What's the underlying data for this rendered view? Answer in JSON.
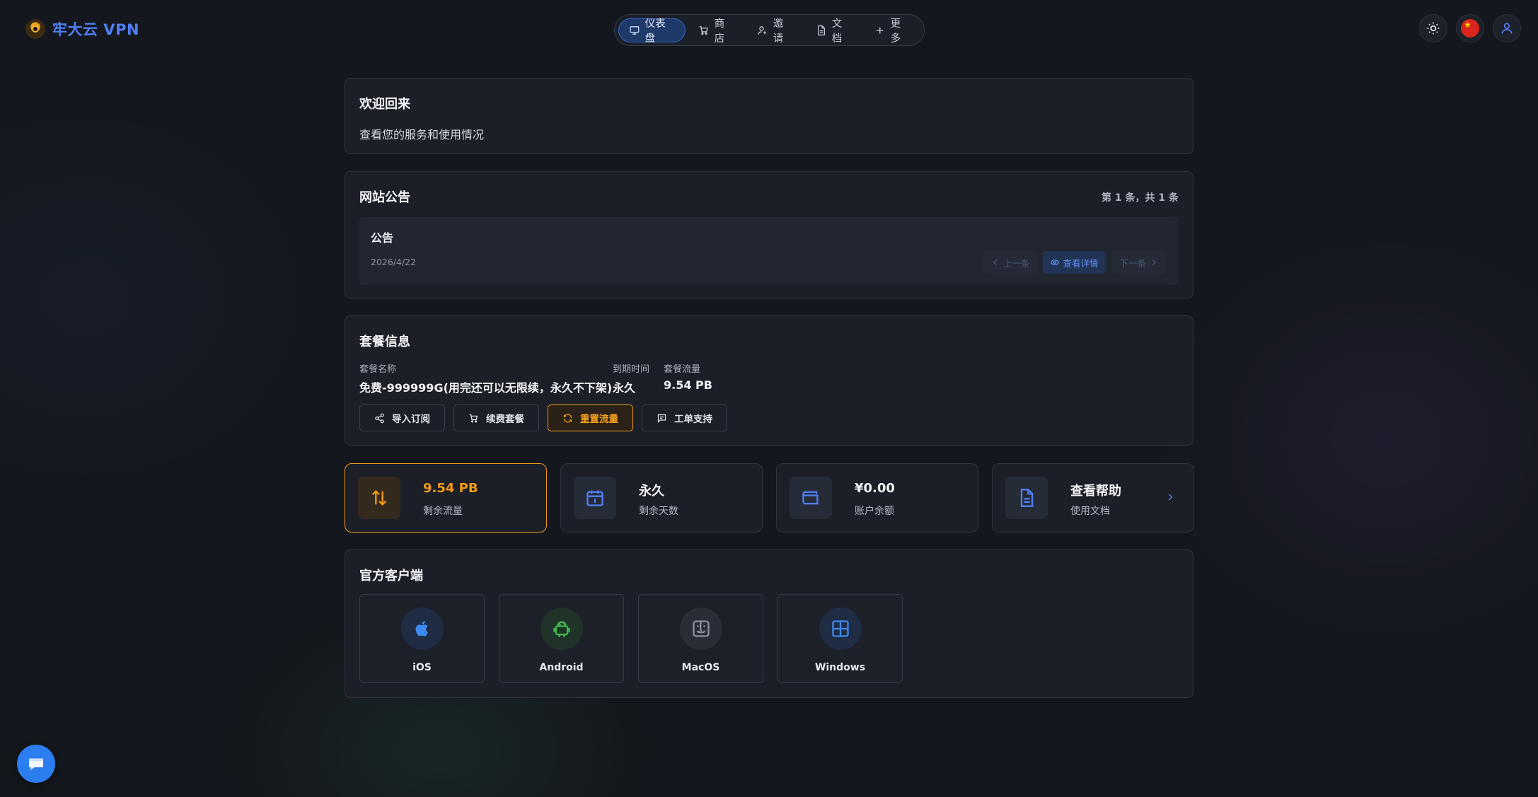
{
  "brand": {
    "name": "牢大云 VPN"
  },
  "nav": {
    "items": [
      {
        "label": "仪表盘",
        "icon": "monitor-icon",
        "active": true
      },
      {
        "label": "商店",
        "icon": "cart-icon"
      },
      {
        "label": "邀请",
        "icon": "user-plus-icon"
      },
      {
        "label": "文档",
        "icon": "document-icon"
      },
      {
        "label": "更多",
        "icon": "plus-icon"
      }
    ]
  },
  "welcome": {
    "title": "欢迎回来",
    "subtitle": "查看您的服务和使用情况"
  },
  "notice": {
    "title": "网站公告",
    "pager": "第 1 条，共 1 条",
    "item": {
      "title": "公告",
      "date": "2026/4/22"
    },
    "prev_label": "上一条",
    "detail_label": "查看详情",
    "next_label": "下一条"
  },
  "plan": {
    "title": "套餐信息",
    "name_label": "套餐名称",
    "name_value": "免费-999999G(用完还可以无限续，永久不下架)",
    "expire_label": "到期时间",
    "expire_value": "永久",
    "traffic_label": "套餐流量",
    "traffic_value": "9.54 PB",
    "actions": {
      "import": "导入订阅",
      "renew": "续费套餐",
      "reset": "重置流量",
      "ticket": "工单支持"
    }
  },
  "stats": [
    {
      "value": "9.54 PB",
      "label": "剩余流量",
      "icon": "traffic-icon"
    },
    {
      "value": "永久",
      "label": "剩余天数",
      "icon": "calendar-icon"
    },
    {
      "value": "¥0.00",
      "label": "账户余额",
      "icon": "wallet-icon"
    },
    {
      "value": "查看帮助",
      "label": "使用文档",
      "icon": "help-doc-icon"
    }
  ],
  "clients": {
    "title": "官方客户端",
    "items": [
      {
        "name": "iOS",
        "icon": "apple-icon"
      },
      {
        "name": "Android",
        "icon": "android-icon"
      },
      {
        "name": "MacOS",
        "icon": "finder-icon"
      },
      {
        "name": "Windows",
        "icon": "windows-icon"
      }
    ]
  },
  "colors": {
    "accent_blue": "#3566c8",
    "accent_orange": "#f29a16",
    "background": "#14171d",
    "card": "#1c1f27"
  }
}
